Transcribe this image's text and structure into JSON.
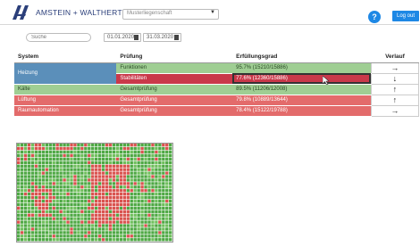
{
  "header": {
    "brand": "AMSTEIN + WALTHERT",
    "building_select": "Musterliegenschaft",
    "help_label": "?",
    "logout_label": "Log out"
  },
  "filters": {
    "search_placeholder": "Suche",
    "date_from": "01.01.2020",
    "date_to": "31.03.2020"
  },
  "table": {
    "columns": [
      "System",
      "Prüfung",
      "Erfüllungsgrad",
      "Verlauf"
    ],
    "rows": [
      {
        "system": "Heizung",
        "pruefung": "Funktionen",
        "erfuellung": "95.7% (15210/15886)",
        "verlauf": "→",
        "status": "green"
      },
      {
        "system": "",
        "pruefung": "Stabilitäten",
        "erfuellung": "77.6% (12360/15886)",
        "verlauf": "↓",
        "status": "dark-red"
      },
      {
        "system": "Kälte",
        "pruefung": "Gesamtprüfung",
        "erfuellung": "89.5% (11206/12008)",
        "verlauf": "↑",
        "status": "green"
      },
      {
        "system": "Lüftung",
        "pruefung": "Gesamtprüfung",
        "erfuellung": "79.8% (10889/13644)",
        "verlauf": "↑",
        "status": "red"
      },
      {
        "system": "Raumautomation",
        "pruefung": "Gesamtprüfung",
        "erfuellung": "78.4% (15122/19788)",
        "verlauf": "→",
        "status": "red"
      }
    ]
  },
  "colors": {
    "brand_blue": "#1e88e5",
    "ok_green": "#9fce93",
    "warn_red": "#e36b6b",
    "alert_red": "#c9394a",
    "selected_system": "#5b8fba"
  }
}
